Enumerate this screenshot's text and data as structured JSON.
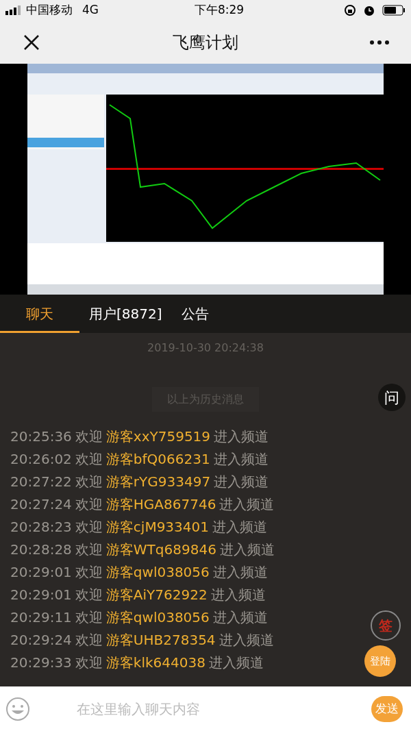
{
  "status_bar": {
    "carrier": "中国移动",
    "network": "4G",
    "time": "下午8:29"
  },
  "nav": {
    "title": "飞鹰计划"
  },
  "tabs": [
    {
      "label": "聊天",
      "selected": true
    },
    {
      "label": "用户[8872]",
      "selected": false
    },
    {
      "label": "公告",
      "selected": false
    }
  ],
  "chat": {
    "timestamp": "2019-10-30 20:24:38",
    "history_note": "以上为历史消息",
    "messages": [
      {
        "time": "20:25:36",
        "verb": "欢迎",
        "user": "游客xxY759519",
        "action": "进入频道"
      },
      {
        "time": "20:26:02",
        "verb": "欢迎",
        "user": "游客bfQ066231",
        "action": "进入频道"
      },
      {
        "time": "20:27:22",
        "verb": "欢迎",
        "user": "游客rYG933497",
        "action": "进入频道"
      },
      {
        "time": "20:27:24",
        "verb": "欢迎",
        "user": "游客HGA867746",
        "action": "进入频道"
      },
      {
        "time": "20:28:23",
        "verb": "欢迎",
        "user": "游客cjM933401",
        "action": "进入频道"
      },
      {
        "time": "20:28:28",
        "verb": "欢迎",
        "user": "游客WTq689846",
        "action": "进入频道"
      },
      {
        "time": "20:29:01",
        "verb": "欢迎",
        "user": "游客qwl038056",
        "action": "进入频道"
      },
      {
        "time": "20:29:01",
        "verb": "欢迎",
        "user": "游客AiY762922",
        "action": "进入频道"
      },
      {
        "time": "20:29:11",
        "verb": "欢迎",
        "user": "游客qwl038056",
        "action": "进入频道"
      },
      {
        "time": "20:29:24",
        "verb": "欢迎",
        "user": "游客UHB278354",
        "action": "进入频道"
      },
      {
        "time": "20:29:33",
        "verb": "欢迎",
        "user": "游客klk644038",
        "action": "进入频道"
      }
    ]
  },
  "floating": {
    "ask": "问",
    "sign": "签",
    "login": "登陆"
  },
  "input_bar": {
    "placeholder": "在这里输入聊天内容",
    "send": "发送"
  }
}
